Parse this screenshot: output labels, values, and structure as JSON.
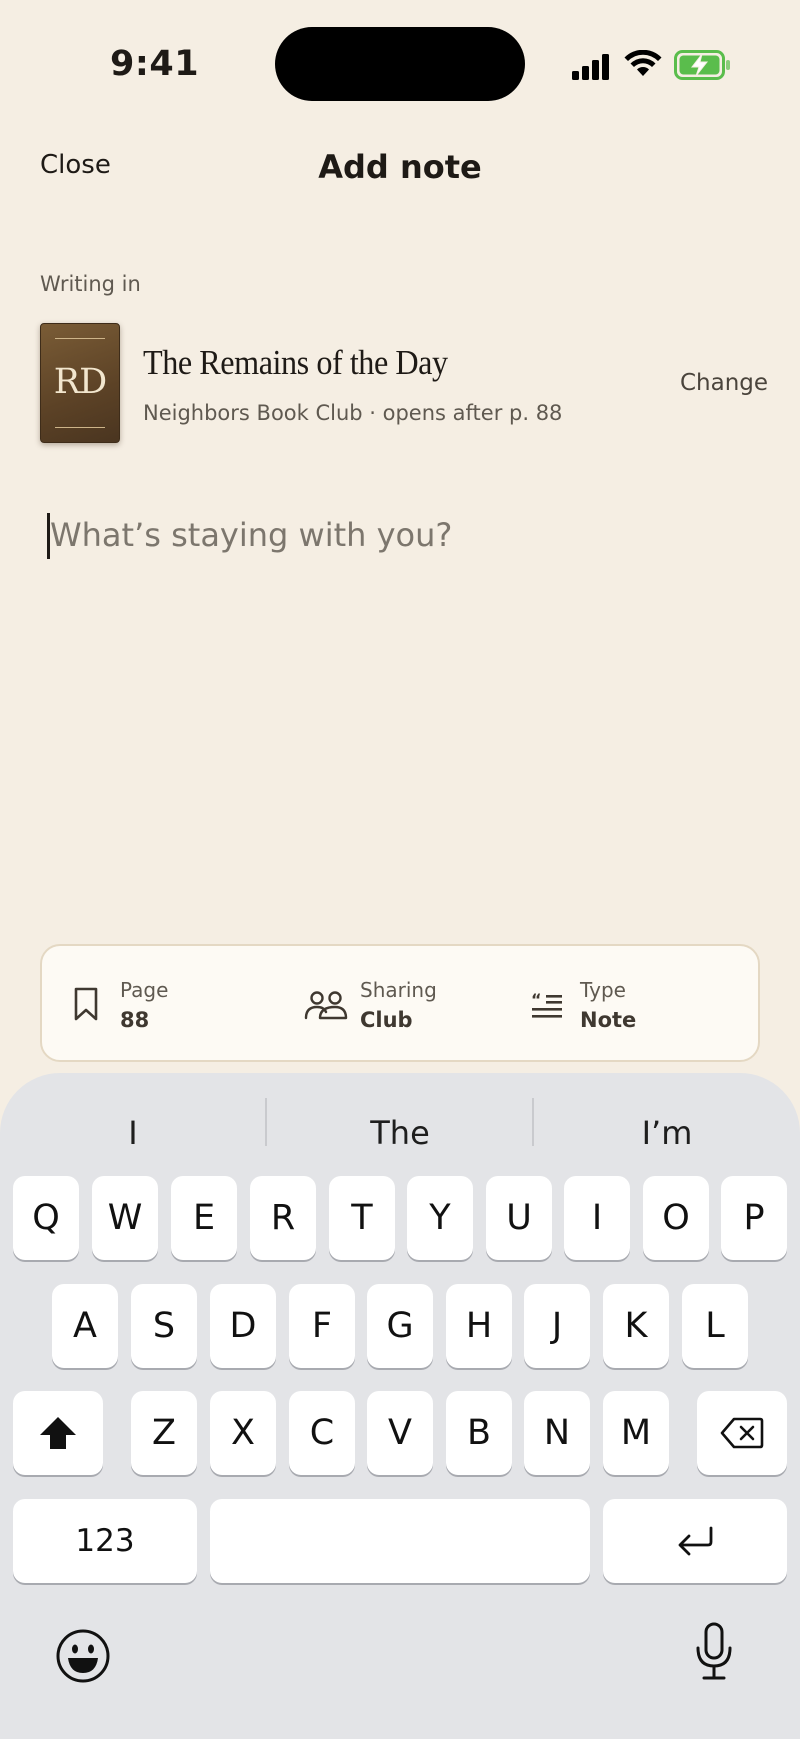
{
  "status_bar": {
    "time": "9:41",
    "icons": [
      "signal-icon",
      "wifi-icon",
      "battery-charging-icon"
    ],
    "battery_color": "#5ABD4C"
  },
  "nav": {
    "close_label": "Close",
    "title": "Add note"
  },
  "writing_in": {
    "label": "Writing in",
    "book_initials": "RD",
    "book_title": "The Remains of the Day",
    "subtitle": "Neighbors Book Club · opens after p. 88",
    "change_label": "Change"
  },
  "note": {
    "placeholder": "What’s staying with you?",
    "value": ""
  },
  "meta": [
    {
      "icon": "bookmark-icon",
      "label": "Page",
      "value": "88"
    },
    {
      "icon": "people-icon",
      "label": "Sharing",
      "value": "Club"
    },
    {
      "icon": "quote-icon",
      "label": "Type",
      "value": "Note"
    }
  ],
  "keyboard": {
    "suggestions": [
      "I",
      "The",
      "I’m"
    ],
    "rows": [
      [
        "Q",
        "W",
        "E",
        "R",
        "T",
        "Y",
        "U",
        "I",
        "O",
        "P"
      ],
      [
        "A",
        "S",
        "D",
        "F",
        "G",
        "H",
        "J",
        "K",
        "L"
      ],
      [
        "Z",
        "X",
        "C",
        "V",
        "B",
        "N",
        "M"
      ]
    ],
    "numbers_label": "123",
    "icons": [
      "shift-icon",
      "backspace-icon",
      "return-icon",
      "emoji-icon",
      "microphone-icon"
    ]
  },
  "colors": {
    "background": "#F5EEE3",
    "toolbar_background": "#FDFAF4",
    "book_cover": "#5C4226",
    "keyboard_background": "#E3E4E7"
  }
}
